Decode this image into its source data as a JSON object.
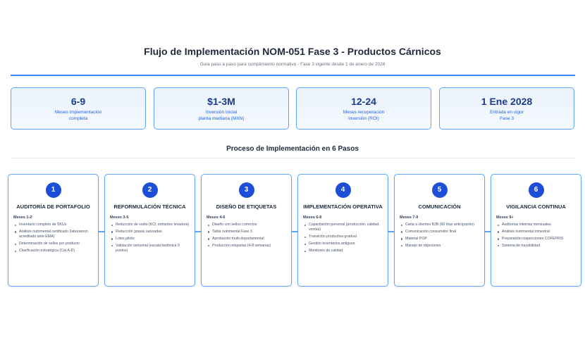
{
  "header": {
    "title": "Flujo de Implementación NOM-051 Fase 3 - Productos Cárnicos",
    "subtitle": "Guía paso a paso para cumplimiento normativo - Fase 3 vigente desde 1 de enero de 2028"
  },
  "kpis": [
    {
      "value": "6-9",
      "label_line1": "Meses implementación",
      "label_line2": "completa"
    },
    {
      "value": "$1-3M",
      "label_line1": "Inversión inicial",
      "label_line2": "planta mediana (MXN)"
    },
    {
      "value": "12-24",
      "label_line1": "Meses recuperación",
      "label_line2": "inversión (ROI)"
    },
    {
      "value": "1 Ene 2028",
      "label_line1": "Entrada en vigor",
      "label_line2": "Fase 3"
    }
  ],
  "process": {
    "title": "Proceso de Implementación en 6 Pasos"
  },
  "steps": [
    {
      "number": "1",
      "title": "AUDITORÍA DE PORTAFOLIO",
      "months": "Meses 1-2",
      "items": [
        "Inventario completo de SKUs",
        "Análisis nutrimental certificado (laboratorio acreditado ante EMA)",
        "Determinación de sellos por producto",
        "Clasificación estratégica (Cat A-D)"
      ]
    },
    {
      "number": "2",
      "title": "REFORMULACIÓN TÉCNICA",
      "months": "Meses 3-5",
      "items": [
        "Reducción de sodio (KCl, extractos levadura)",
        "Reducción grasas saturadas",
        "Lotes piloto",
        "Validación sensorial (escala hedónica 9 puntos)"
      ]
    },
    {
      "number": "3",
      "title": "DISEÑO DE ETIQUETAS",
      "months": "Meses 4-6",
      "items": [
        "Diseño con sellos correctos",
        "Tabla nutrimental Fase 3",
        "Aprobación multi-departamental",
        "Producción etiquetas (4-8 semanas)"
      ]
    },
    {
      "number": "4",
      "title": "IMPLEMENTACIÓN OPERATIVA",
      "months": "Meses 6-8",
      "items": [
        "Capacitación personal (producción, calidad, ventas)",
        "Transición productiva gradual",
        "Gestión inventarios antiguos",
        "Monitoreo de calidad"
      ]
    },
    {
      "number": "5",
      "title": "COMUNICACIÓN",
      "months": "Meses 7-9",
      "items": [
        "Carta a clientes B2B (60 días anticipación)",
        "Comunicación consumidor final",
        "Material POP",
        "Manejo de objeciones"
      ]
    },
    {
      "number": "6",
      "title": "VIGILANCIA CONTINUA",
      "months": "Meses 9+",
      "items": [
        "Auditorías internas mensuales",
        "Análisis nutrimental trimestral",
        "Preparación inspecciones COFEPRIS",
        "Sistema de trazabilidad"
      ]
    }
  ]
}
